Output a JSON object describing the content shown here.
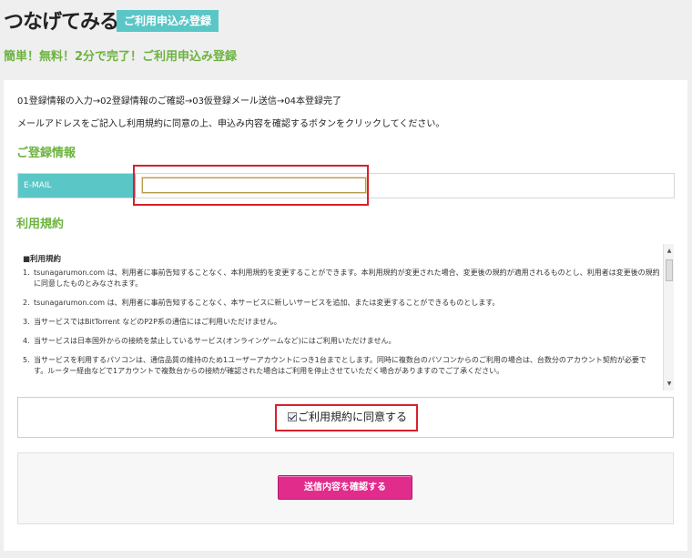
{
  "header": {
    "logo_text": "つなげてみる",
    "badge": "ご利用申込み登録"
  },
  "tagline": "簡単！無料！2分で完了！ご利用申込み登録",
  "form": {
    "steps": "01登録情報の入力→02登録情報のご確認→03仮登録メール送信→04本登録完了",
    "instruction": "メールアドレスをご記入し利用規約に同意の上、申込み内容を確認するボタンをクリックしてください。",
    "registration_title": "ご登録情報",
    "email_label": "E-MAIL",
    "email_value": "",
    "terms_title": "利用規約"
  },
  "terms": {
    "heading": "■利用規約",
    "items": [
      {
        "num": "1.",
        "text": "tsunagarumon.com は、利用者に事前告知することなく、本利用規約を変更することができます。本利用規約が変更された場合、変更後の規約が適用されるものとし、利用者は変更後の規約に同意したものとみなされます。"
      },
      {
        "num": "2.",
        "text": "tsunagarumon.com は、利用者に事前告知することなく、本サービスに新しいサービスを追加、または変更することができるものとします。"
      },
      {
        "num": "3.",
        "text": "当サービスではBitTorrent などのP2P系の通信にはご利用いただけません。"
      },
      {
        "num": "4.",
        "text": "当サービスは日本国外からの接続を禁止しているサービス(オンラインゲームなど)にはご利用いただけません。"
      },
      {
        "num": "5.",
        "text": "当サービスを利用するパソコンは、通信品質の維持のため1ユーザーアカウントにつき1台までとします。同時に複数台のパソコンからのご利用の場合は、台数分のアカウント契約が必要です。ルーター経由などで1アカウントで複数台からの接続が確認された場合はご利用を停止させていただく場合がありますのでご了承ください。"
      }
    ]
  },
  "agree": {
    "label": "ご利用規約に同意する",
    "checked": true
  },
  "submit": {
    "label": "送信内容を確認する"
  },
  "colors": {
    "accent_teal": "#5bc6c6",
    "accent_green": "#6db33f",
    "submit_pink": "#e12c8c",
    "highlight_red": "#d8202c"
  }
}
